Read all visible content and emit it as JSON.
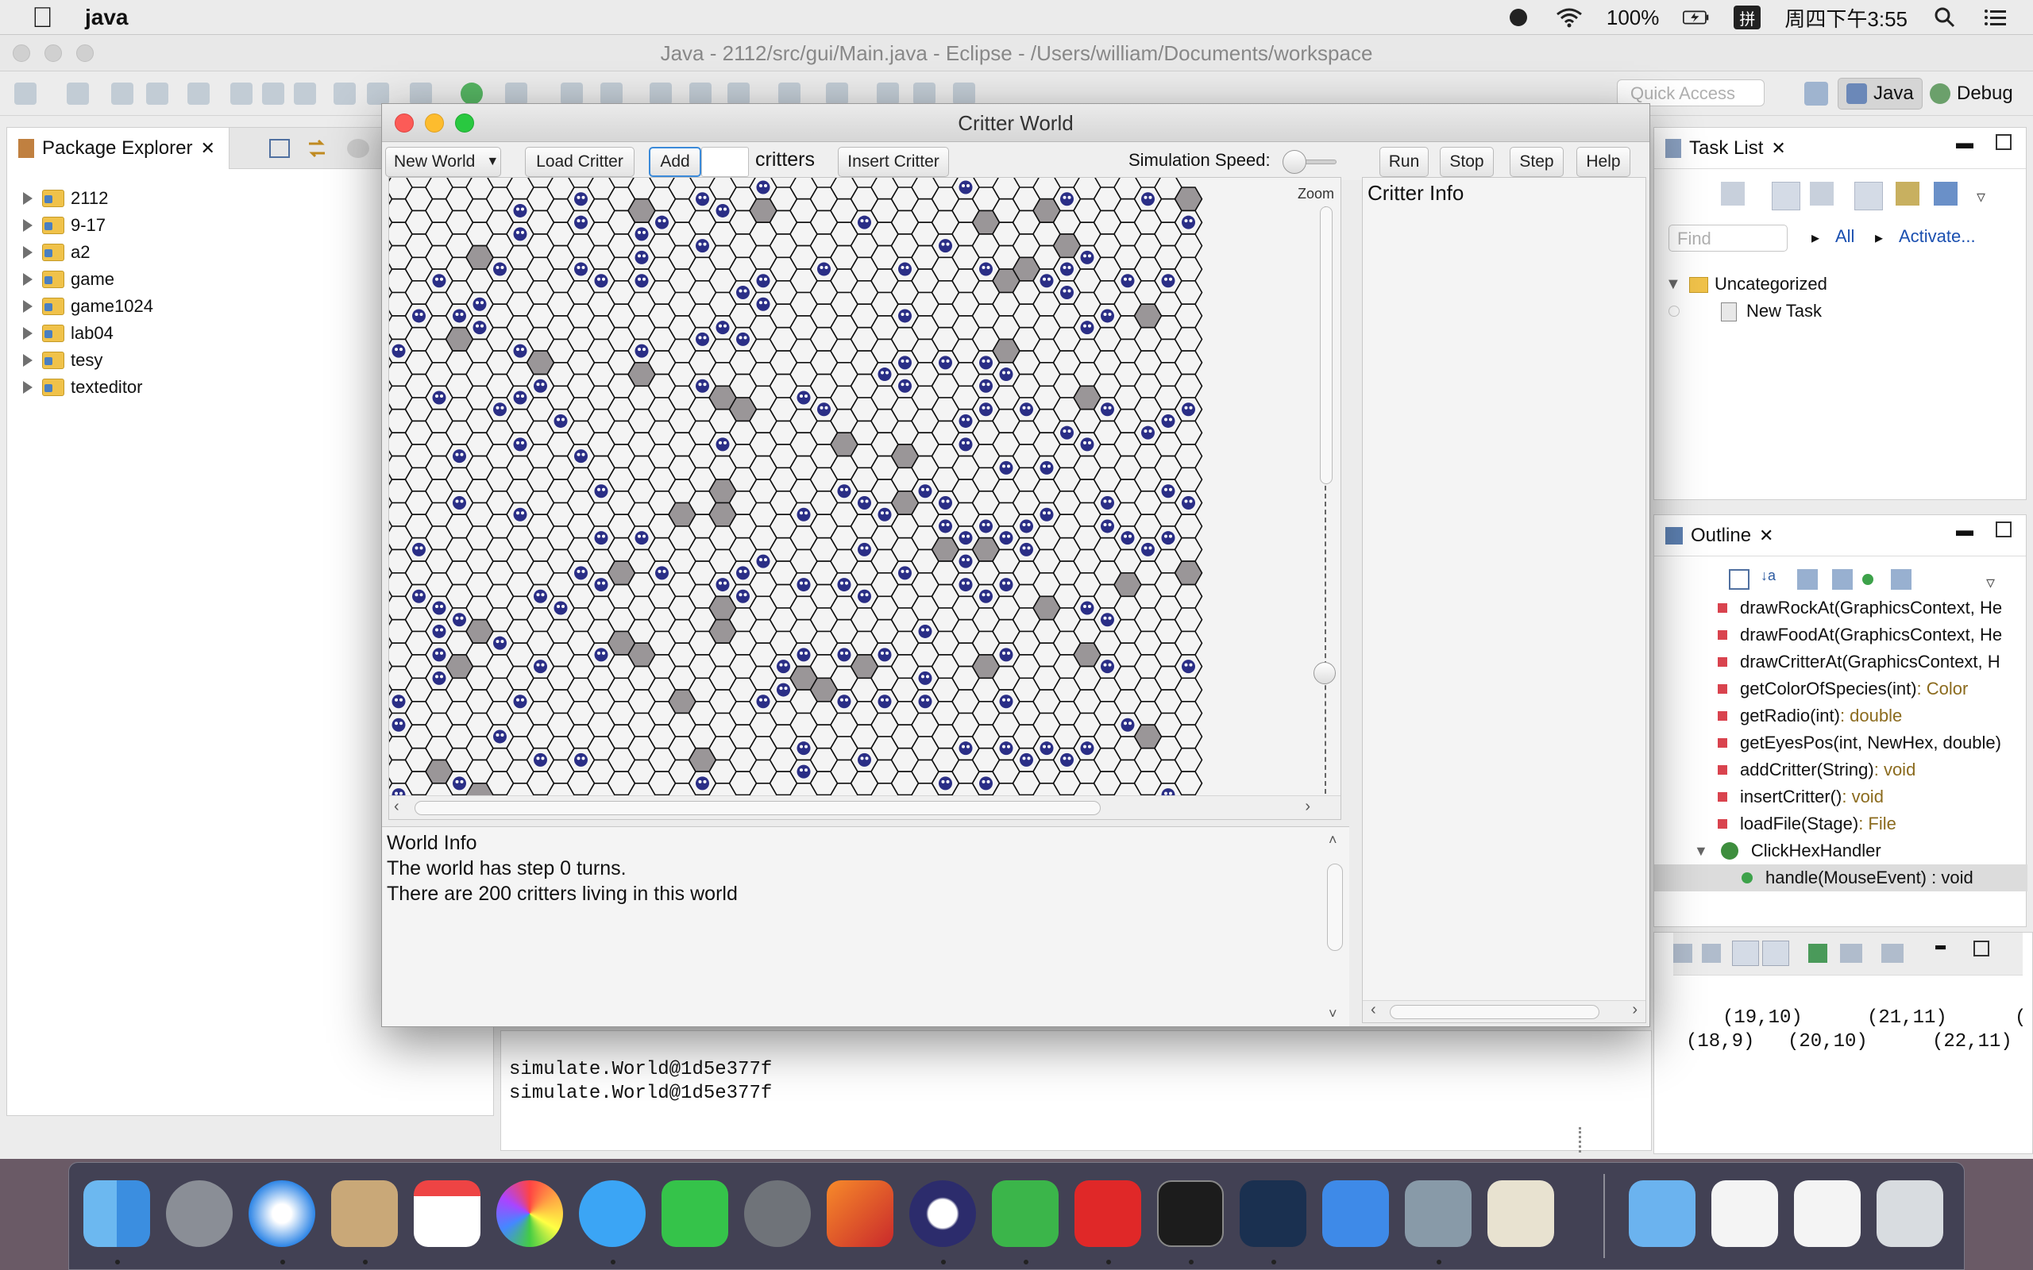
{
  "menubar": {
    "app_name": "java",
    "battery": "100%",
    "input_method": "拼",
    "clock": "周四下午3:55"
  },
  "eclipse": {
    "title": "Java - 2112/src/gui/Main.java - Eclipse - /Users/william/Documents/workspace",
    "quick_access_placeholder": "Quick Access",
    "perspectives": [
      "Java",
      "Debug"
    ]
  },
  "package_explorer": {
    "tab_label": "Package Explorer",
    "projects": [
      "2112",
      "9-17",
      "a2",
      "game",
      "game1024",
      "lab04",
      "tesy",
      "texteditor"
    ]
  },
  "console": {
    "lines": [
      "simulate.World@1d5e377f",
      "simulate.World@1d5e377f"
    ]
  },
  "task_list": {
    "tab_label": "Task List",
    "find_placeholder": "Find",
    "all_label": "All",
    "activate_label": "Activate...",
    "category": "Uncategorized",
    "task": "New Task"
  },
  "outline": {
    "tab_label": "Outline",
    "items": [
      {
        "name": "drawRockAt(GraphicsContext, He",
        "type": ""
      },
      {
        "name": "drawFoodAt(GraphicsContext, He",
        "type": ""
      },
      {
        "name": "drawCritterAt(GraphicsContext, H",
        "type": ""
      },
      {
        "name": "getColorOfSpecies(int)",
        "type": " : Color"
      },
      {
        "name": "getRadio(int)",
        "type": " : double"
      },
      {
        "name": "getEyesPos(int, NewHex, double)",
        "type": ""
      },
      {
        "name": "addCritter(String)",
        "type": " : void"
      },
      {
        "name": "insertCritter()",
        "type": " : void"
      },
      {
        "name": "loadFile(Stage)",
        "type": " : File"
      }
    ],
    "class_item": "ClickHexHandler",
    "method_item": "handle(MouseEvent) : void"
  },
  "coords_view": {
    "row1": [
      "(19,10)",
      "(21,11)",
      "("
    ],
    "row2": [
      "(18,9)",
      "(20,10)",
      "(22,11)"
    ]
  },
  "critter_world": {
    "title": "Critter World",
    "new_world": "New World",
    "load_critter": "Load Critter",
    "add": "Add",
    "critters_label": "critters",
    "insert_critter": "Insert Critter",
    "speed_label": "Simulation Speed:",
    "run": "Run",
    "stop": "Stop",
    "step": "Step",
    "help": "Help",
    "zoom_label": "Zoom",
    "critter_info_title": "Critter Info",
    "world_info_title": "World Info",
    "world_info_line1": "The world has step 0 turns.",
    "world_info_line2": "There are 200 critters living in this world"
  },
  "colors": {
    "critter": "#2a2e86",
    "rock": "#9a9698",
    "hex_stroke": "#111111",
    "hex_fill": "#f4f4f4"
  }
}
